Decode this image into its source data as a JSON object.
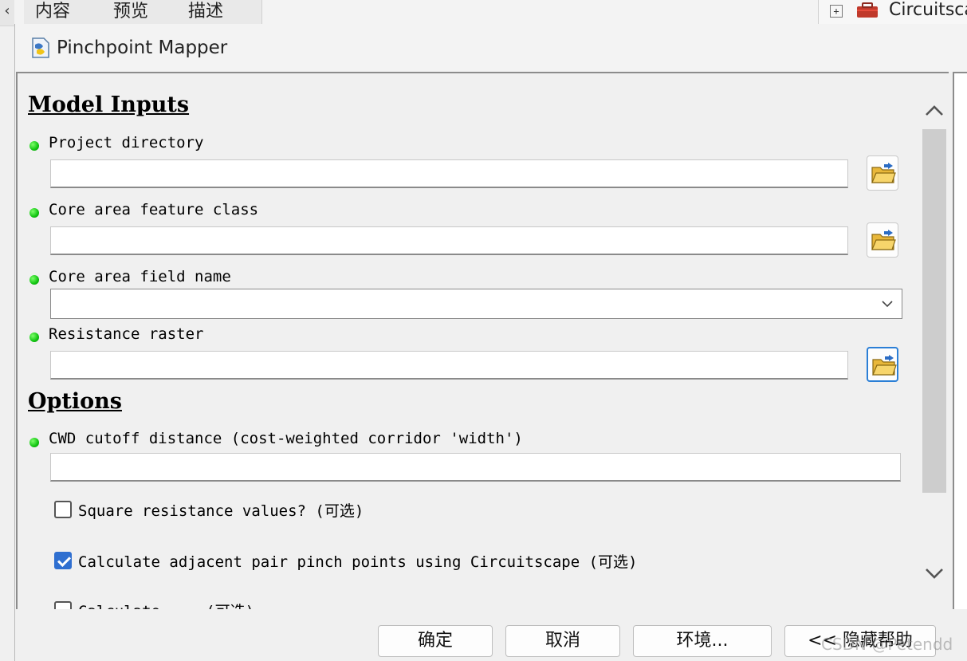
{
  "background_app": {
    "tabs": [
      "内容",
      "预览",
      "描述"
    ],
    "right_panel_expand": "+",
    "right_panel_label": "Circuitsca"
  },
  "dialog": {
    "title": "Pinchpoint Mapper",
    "sections": {
      "model_inputs": "Model Inputs",
      "options": "Options"
    },
    "params": {
      "project_directory": {
        "label": "Project directory",
        "value": ""
      },
      "core_area_feature_class": {
        "label": "Core area feature class",
        "value": ""
      },
      "core_area_field_name": {
        "label": "Core area field name",
        "value": ""
      },
      "resistance_raster": {
        "label": "Resistance raster",
        "value": ""
      },
      "cwd_cutoff": {
        "label": "CWD cutoff distance (cost-weighted corridor 'width')",
        "value": ""
      }
    },
    "checkboxes": [
      {
        "label": "Square resistance values? (可选)",
        "checked": false
      },
      {
        "label": "Calculate adjacent pair pinch points using Circuitscape (可选)",
        "checked": true
      },
      {
        "label": "Calculate ... (可选)",
        "checked": false
      }
    ],
    "buttons": {
      "ok": "确定",
      "cancel": "取消",
      "environments": "环境...",
      "hide_help": "<< 隐藏帮助"
    },
    "watermark": "CSDN @Petendd"
  },
  "colors": {
    "required_dot": "#11c411",
    "focus_border": "#2b7fd6",
    "checkbox_checked": "#2f6fd0"
  },
  "icons": {
    "folder": "open-folder-icon",
    "chevron_down": "chevron-down-icon",
    "scroll_up": "chevron-up-icon",
    "scroll_down": "chevron-down-icon",
    "tool": "python-script-icon"
  }
}
